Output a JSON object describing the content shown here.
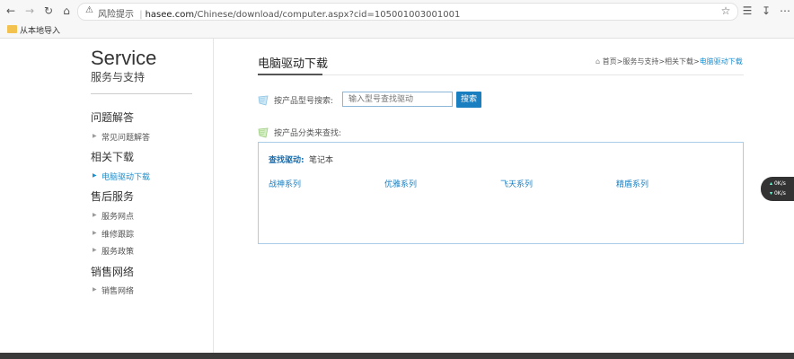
{
  "browser": {
    "security_label": "风险提示",
    "separator": "|",
    "url_host": "hasee.com",
    "url_path": "/Chinese/download/computer.aspx?cid=105001003001001",
    "bookmark_label": "从本地导入",
    "icons": [
      "back-arrow-icon",
      "forward-arrow-icon",
      "reload-icon",
      "home-icon",
      "warning-icon",
      "star-icon",
      "collections-icon",
      "download-icon",
      "more-icon"
    ]
  },
  "sidebar": {
    "logo_en": "Service",
    "logo_cn": "服务与支持",
    "sections": [
      {
        "title": "问题解答",
        "items": [
          "常见问题解答"
        ]
      },
      {
        "title": "相关下载",
        "items": [
          "电脑驱动下载"
        ]
      },
      {
        "title": "售后服务",
        "items": [
          "服务网点",
          "维修跟踪",
          "服务政策"
        ]
      },
      {
        "title": "销售网络",
        "items": [
          "销售网络"
        ]
      }
    ],
    "active_item": "电脑驱动下载"
  },
  "main": {
    "title": "电脑驱动下载",
    "breadcrumb": {
      "home": "首页",
      "sep": ">",
      "level1": "服务与支持",
      "level2": "相关下载",
      "current": "电脑驱动下载"
    },
    "search": {
      "label": "按产品型号搜索:",
      "placeholder": "输入型号查找驱动",
      "button": "搜索"
    },
    "category": {
      "label": "按产品分类来查找:"
    },
    "find": {
      "label": "查找驱动:",
      "value": "笔记本"
    },
    "series": [
      "战神系列",
      "优雅系列",
      "飞天系列",
      "精盾系列"
    ]
  },
  "widget": {
    "row1": "0",
    "row1_unit": "K/s",
    "row2": "0",
    "row2_unit": "K/s"
  },
  "colors": {
    "accent": "#1a7fc1",
    "active_link": "#1a8fd0",
    "box_border": "#a9cde8"
  }
}
